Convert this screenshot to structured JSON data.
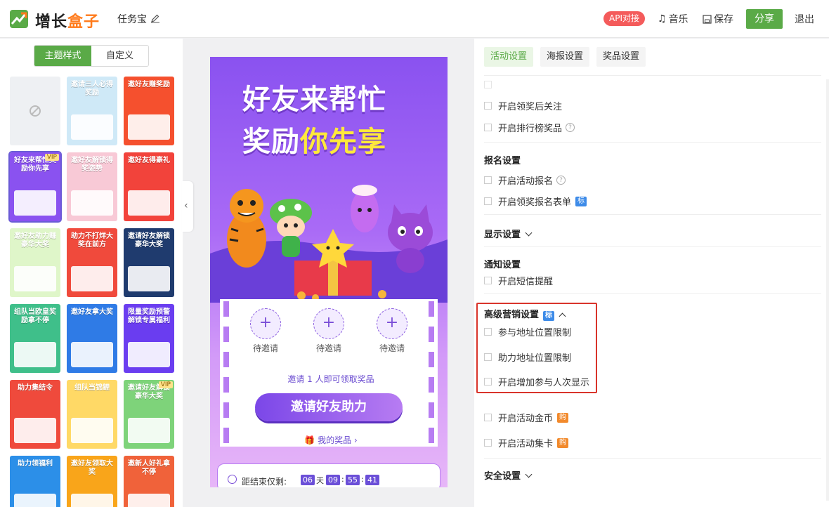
{
  "header": {
    "brand_a": "增长",
    "brand_b": "盒子",
    "task_name": "任务宝",
    "api_badge": "API对接",
    "music": "音乐",
    "save": "保存",
    "share": "分享",
    "exit": "退出",
    "colors": {
      "brand": "#ff7a1a",
      "primary": "#5aaa47",
      "badge": "#f45b5b"
    }
  },
  "left_panel": {
    "tabs": [
      "主题样式",
      "自定义"
    ],
    "active_tab": 0,
    "templates": [
      {
        "title": "",
        "bg": "#eef0f3",
        "none": true
      },
      {
        "title": "邀请三人必得奖励",
        "bg": "#cfe9f7"
      },
      {
        "title": "邀好友赚奖励",
        "bg": "#f5502e"
      },
      {
        "title": "好友来帮忙奖励你先享",
        "bg": "#8a52f0",
        "vip": "VIP",
        "selected": true
      },
      {
        "title": "邀好友解锁得奖姿势",
        "bg": "#f8c9d6"
      },
      {
        "title": "邀好友得豪礼",
        "bg": "#f2433b"
      },
      {
        "title": "邀好友助力赚豪华大奖",
        "bg": "#dff6c9"
      },
      {
        "title": "助力不打烊大奖在前方",
        "bg": "#f04a3c"
      },
      {
        "title": "邀请好友解锁豪华大奖",
        "bg": "#1f3b6e"
      },
      {
        "title": "组队当欧皇奖励拿不停",
        "bg": "#3fbf8a"
      },
      {
        "title": "邀好友拿大奖",
        "bg": "#2f7be6"
      },
      {
        "title": "限量奖励预警解锁专属福利",
        "bg": "#6a3df0"
      },
      {
        "title": "助力集结令",
        "bg": "#ef4a3c"
      },
      {
        "title": "组队当锦鲤",
        "bg": "#ffd966"
      },
      {
        "title": "邀请好友解锁豪华大奖",
        "bg": "#7ed37a",
        "vip": "VIP"
      },
      {
        "title": "助力领福利",
        "bg": "#2c8fe8"
      },
      {
        "title": "邀好友领取大奖",
        "bg": "#f9a51a"
      },
      {
        "title": "邀新人好礼拿不停",
        "bg": "#f0623a"
      }
    ]
  },
  "preview": {
    "title_line1": "好友来帮忙",
    "title_line2_white": "奖励",
    "title_line2_yellow": "你先享",
    "slots": [
      "待邀请",
      "待邀请",
      "待邀请"
    ],
    "hint": "邀请 1 人即可领取奖品",
    "cta": "邀请好友助力",
    "my_prize": "我的奖品",
    "countdown_label": "距结束仅剩:",
    "countdown": {
      "days": "06",
      "day_unit": "天",
      "hours": "09",
      "minutes": "55",
      "seconds": "41"
    }
  },
  "settings": {
    "tabs": [
      "活动设置",
      "海报设置",
      "奖品设置"
    ],
    "active_tab": 0,
    "items_top": [
      "开启领奖后关注",
      "开启排行榜奖品"
    ],
    "signup_title": "报名设置",
    "signup_items": [
      "开启活动报名",
      "开启领奖报名表单"
    ],
    "display_title": "显示设置",
    "notify_title": "通知设置",
    "notify_items": [
      "开启短信提醒"
    ],
    "advanced_title": "高级营销设置",
    "advanced_items": [
      "参与地址位置限制",
      "助力地址位置限制",
      "开启增加参与人次显示"
    ],
    "extra_items": [
      "开启活动金币",
      "开启活动集卡"
    ],
    "security_title": "安全设置",
    "tag_std": "标",
    "tag_buy": "购"
  }
}
